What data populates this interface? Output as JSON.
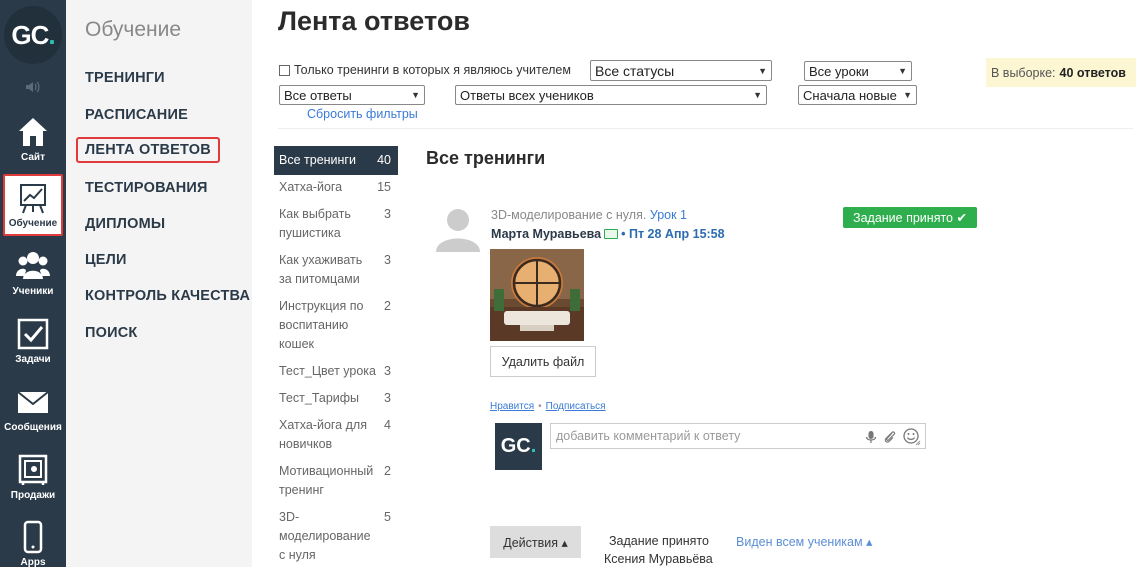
{
  "rail": {
    "logo": {
      "letters": "GC",
      "dot": "."
    },
    "items": [
      {
        "label": "Сайт",
        "icon": "home-icon"
      },
      {
        "label": "Обучение",
        "icon": "chart-board-icon"
      },
      {
        "label": "Ученики",
        "icon": "users-icon"
      },
      {
        "label": "Задачи",
        "icon": "checkbox-icon"
      },
      {
        "label": "Сообщения",
        "icon": "envelope-icon"
      },
      {
        "label": "Продажи",
        "icon": "safe-icon"
      },
      {
        "label": "Apps",
        "icon": "phone-icon"
      }
    ]
  },
  "subnav": {
    "title": "Обучение",
    "items": [
      {
        "label": "ТРЕНИНГИ"
      },
      {
        "label": "РАСПИСАНИЕ"
      },
      {
        "label": "ЛЕНТА ОТВЕТОВ"
      },
      {
        "label": "ТЕСТИРОВАНИЯ"
      },
      {
        "label": "ДИПЛОМЫ"
      },
      {
        "label": "ЦЕЛИ"
      },
      {
        "label": "КОНТРОЛЬ КАЧЕСТВА"
      },
      {
        "label": "ПОИСК"
      }
    ]
  },
  "page": {
    "title": "Лента ответов"
  },
  "filters": {
    "teacher_only_label": "Только тренинги в которых я являюсь учителем",
    "status": "Все статусы",
    "lessons": "Все уроки",
    "answers": "Все ответы",
    "students": "Ответы всех учеников",
    "sort": "Сначала новые",
    "reset": "Сбросить фильтры"
  },
  "selection": {
    "label": "В выборке:",
    "value": "40 ответов"
  },
  "trainings": [
    {
      "name": "Все тренинги",
      "count": "40"
    },
    {
      "name": "Хатха-йога",
      "count": "15"
    },
    {
      "name": "Как выбрать пушистика",
      "count": "3"
    },
    {
      "name": "Как ухаживать за питомцами",
      "count": "3"
    },
    {
      "name": "Инструкция по воспитанию кошек",
      "count": "2"
    },
    {
      "name": "Тест_Цвет урока",
      "count": "3"
    },
    {
      "name": "Тест_Тарифы",
      "count": "3"
    },
    {
      "name": "Хатха-йога для новичков",
      "count": "4"
    },
    {
      "name": "Мотивационный тренинг",
      "count": "2"
    },
    {
      "name": "3D-моделирование с нуля",
      "count": "5"
    }
  ],
  "section": {
    "title": "Все тренинги"
  },
  "answer": {
    "course": "3D-моделирование с нуля.",
    "lesson": "Урок 1",
    "author": "Марта Муравьева",
    "date": "• Пт 28 Апр 15:58",
    "status": "Задание принято ✔",
    "delete_label": "Удалить файл",
    "like_label": "Нравится",
    "subscribe_label": "Подписаться",
    "comment_placeholder": "добавить комментарий к ответу"
  },
  "footer": {
    "actions_label": "Действия ▴",
    "status_text": "Задание принято",
    "status_author": "Ксения Муравьёва",
    "visibility": "Виден всем ученикам ▴"
  },
  "colors": {
    "rail": "#2b3a48",
    "accent_green": "#2fae4e",
    "link": "#3a7bd5",
    "highlight_border": "#e03a3a"
  }
}
